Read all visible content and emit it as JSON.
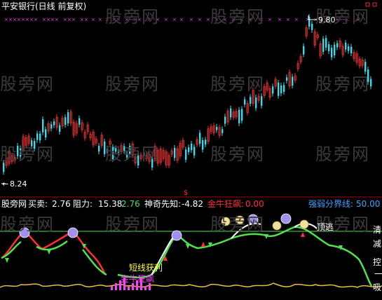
{
  "main_title": "平安银行(日线 前复权)",
  "price_high_label": "9.80",
  "price_low_label": "8.24",
  "arrow_low": "←",
  "dollar_marker": "$",
  "indicator": {
    "name": "股旁网",
    "buy_sell_label": "买卖:",
    "buy_sell_value": "2.76",
    "resistance_label": "阻力:",
    "resistance_value": "15.38",
    "extra_value": "2.76",
    "foresight_label": "神奇先知:",
    "foresight_value": "-4.82",
    "golden_bull_label": "金牛狂飙:",
    "golden_bull_value": "0.00",
    "strength_line_label": "强弱分界线:",
    "strength_line_value": "50.00"
  },
  "annotations": {
    "short_term": "短线获利",
    "golden_bull": "金牛狂飙",
    "top_escape": "顶逃",
    "right_labels": [
      "清",
      "减",
      "控",
      "一",
      "吸"
    ]
  },
  "watermark": "股旁网",
  "colors": {
    "background": "#000000",
    "up_candle": "#e03030",
    "down_candle": "#40d8e8",
    "green_line": "#50e050",
    "red_line": "#ff3030",
    "yellow": "#ffff40",
    "magenta": "#ff40ff"
  }
}
